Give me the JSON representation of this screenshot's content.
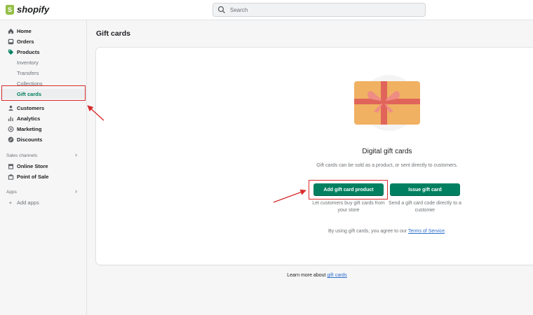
{
  "topbar": {
    "brand": "shopify",
    "search_placeholder": "Search"
  },
  "sidebar": {
    "items": [
      {
        "label": "Home",
        "icon": "home-icon"
      },
      {
        "label": "Orders",
        "icon": "orders-icon"
      },
      {
        "label": "Products",
        "icon": "tag-icon"
      }
    ],
    "product_sub": [
      "Inventory",
      "Transfers",
      "Collections",
      "Gift cards"
    ],
    "items2": [
      {
        "label": "Customers",
        "icon": "person-icon"
      },
      {
        "label": "Analytics",
        "icon": "bar-chart-icon"
      },
      {
        "label": "Marketing",
        "icon": "target-icon"
      },
      {
        "label": "Discounts",
        "icon": "discount-icon"
      }
    ],
    "sales_channels_label": "Sales channels",
    "channels": [
      {
        "label": "Online Store",
        "icon": "store-icon"
      },
      {
        "label": "Point of Sale",
        "icon": "pos-icon"
      }
    ],
    "apps_label": "Apps",
    "add_apps": "Add apps"
  },
  "main": {
    "page_title": "Gift cards",
    "card": {
      "title": "Digital gift cards",
      "subtitle": "Gift cards can be sold as a product, or sent directly to customers.",
      "add_button": "Add gift card product",
      "issue_button": "Issue gift card",
      "add_desc": "Let customers buy gift cards from your store",
      "issue_desc": "Send a gift card code directly to a customer",
      "terms_prefix": "By using gift cards, you agree to our",
      "terms_link": "Terms of Service",
      "terms_suffix": "."
    },
    "learn_prefix": "Learn more about",
    "learn_link": "gift cards"
  },
  "colors": {
    "accent": "#008060",
    "annotation": "#d72c2c",
    "link": "#2c6ecb"
  }
}
